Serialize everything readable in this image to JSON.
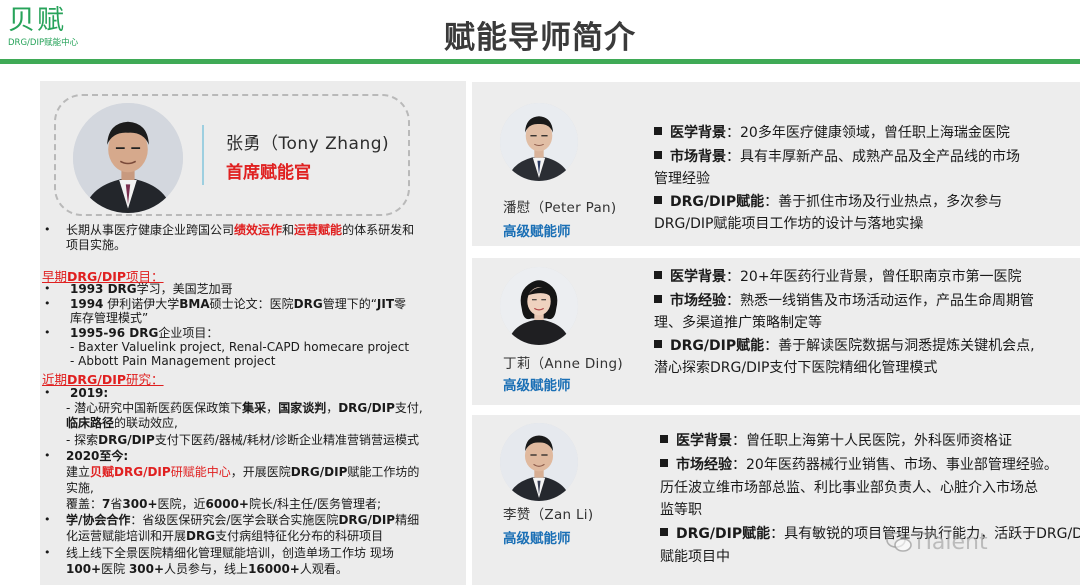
{
  "logo": {
    "main": "贝赋",
    "sub": "DRG/DIP赋能中心"
  },
  "page_title": "赋能导师简介",
  "main_mentor": {
    "name": "张勇（Tony Zhang)",
    "role": "首席赋能官",
    "intro": {
      "line1_a": "长期从事医疗健康企业跨国公司",
      "line1_b": "绩效运作",
      "line1_c": "和",
      "line1_d": "运营赋能",
      "line1_e": "的体系研发和",
      "line2": "项目实施。"
    },
    "early_section": {
      "label_a": "早期",
      "label_b": "DRG/DIP",
      "label_c": "项目："
    },
    "early": {
      "l1_year": "1993 DRG",
      "l1_rest": "学习，美国芝加哥",
      "l2_year": "1994",
      "l2_a": " 伊利诺伊大学",
      "l2_b": "BMA",
      "l2_c": "硕士论文：医院",
      "l2_d": "DRG",
      "l2_e": "管理下的“",
      "l2_f": "JIT",
      "l2_g": "零",
      "l3": "库存管理模式”",
      "l4_year": "1995-96 DRG",
      "l4_rest": "企业项目：",
      "l5": "- Baxter Valuelink project, Renal-CAPD homecare project",
      "l6": "- Abbott Pain Management project"
    },
    "recent_section": {
      "label_a": "近期",
      "label_b": "DRG/DIP",
      "label_c": "研究："
    },
    "recent": {
      "r1": "2019:",
      "r2_a": "- 潜心研究中国新医药医保政策下",
      "r2_b": "集采",
      "r2_c": "，",
      "r2_d": "国家谈判",
      "r2_e": "，",
      "r2_f": "DRG/DIP",
      "r2_g": "支付,",
      "r3_a": "临床路径",
      "r3_b": "的联动效应,",
      "r4_a": "- 探索",
      "r4_b": "DRG/DIP",
      "r4_c": "支付下医药/器械/耗材/诊断企业精准营销营运模式",
      "r5": "2020至今:",
      "r6_a": "建立",
      "r6_b": "贝赋",
      "r6_c": "DRG/DIP",
      "r6_d": "研赋能中心",
      "r6_e": "，开展医院",
      "r6_f": "DRG/DIP",
      "r6_g": "赋能工作坊的",
      "r7": "实施,",
      "r8_a": "覆盖：",
      "r8_b": "7",
      "r8_c": "省",
      "r8_d": "300+",
      "r8_e": "医院，近",
      "r8_f": "6000+",
      "r8_g": "院长/科主任/医务管理者;",
      "r9_a": "学/协会合作",
      "r9_b": "：省级医保研究会/医学会联合实施医院",
      "r9_c": "DRG/DIP",
      "r9_d": "精细",
      "r10_a": "化运营赋能培训和开展",
      "r10_b": "DRG",
      "r10_c": "支付病组特征化分布的科研项目",
      "r11": "线上线下全景医院精细化管理赋能培训，创造单场工作坊 现场",
      "r12_a": "100+",
      "r12_b": "医院 ",
      "r12_c": "300+",
      "r12_d": "人员参与，线上",
      "r12_e": "16000+",
      "r12_f": "人观看。"
    }
  },
  "mentors": [
    {
      "name": "潘慰（Peter Pan)",
      "role": "高级赋能师",
      "lines": [
        {
          "label": "医学背景",
          "text": "：20多年医疗健康领域，曾任职上海瑞金医院"
        },
        {
          "label": "市场背景",
          "text": "：具有丰厚新产品、成熟产品及全产品线的市场"
        },
        {
          "label": "",
          "text": "管理经验"
        },
        {
          "label": "DRG/DIP赋能",
          "text": "：善于抓住市场及行业热点，多次参与"
        },
        {
          "label": "",
          "text": "DRG/DIP赋能项目工作坊的设计与落地实操"
        }
      ]
    },
    {
      "name": "丁莉（Anne Ding)",
      "role": "高级赋能师",
      "lines": [
        {
          "label": "医学背景",
          "text": "：20+年医药行业背景，曾任职南京市第一医院"
        },
        {
          "label": "市场经验",
          "text": "：熟悉一线销售及市场活动运作，产品生命周期管"
        },
        {
          "label": "",
          "text": "理、多渠道推广策略制定等"
        },
        {
          "label": "DRG/DIP赋能",
          "text": "：善于解读医院数据与洞悉提炼关键机会点,"
        },
        {
          "label": "",
          "text": "潜心探索DRG/DIP支付下医院精细化管理模式"
        }
      ]
    },
    {
      "name": "李赞（Zan Li)",
      "role": "高级赋能师",
      "lines": [
        {
          "label": "医学背景",
          "text": "：曾任职上海第十人民医院，外科医师资格证"
        },
        {
          "label": "市场经验",
          "text": "：20年医药器械行业销售、市场、事业部管理经验。"
        },
        {
          "label": "",
          "text": "历任波立维市场部总监、利比事业部负责人、心脏介入市场总"
        },
        {
          "label": "",
          "text": "监等职"
        },
        {
          "label": "DRG/DIP赋能",
          "text": "：具有敏锐的项目管理与执行能力，活跃于DRG/DIP"
        },
        {
          "label": "",
          "text": "赋能项目中"
        }
      ]
    }
  ],
  "watermark": "iTalent",
  "icons": {
    "bullet": "square-bullet-icon",
    "watermark": "wechat-icon"
  },
  "colors": {
    "brand_green": "#27a35a",
    "divider_green": "#3faa56",
    "accent_red": "#e02020",
    "role_blue": "#1a6fb5"
  }
}
